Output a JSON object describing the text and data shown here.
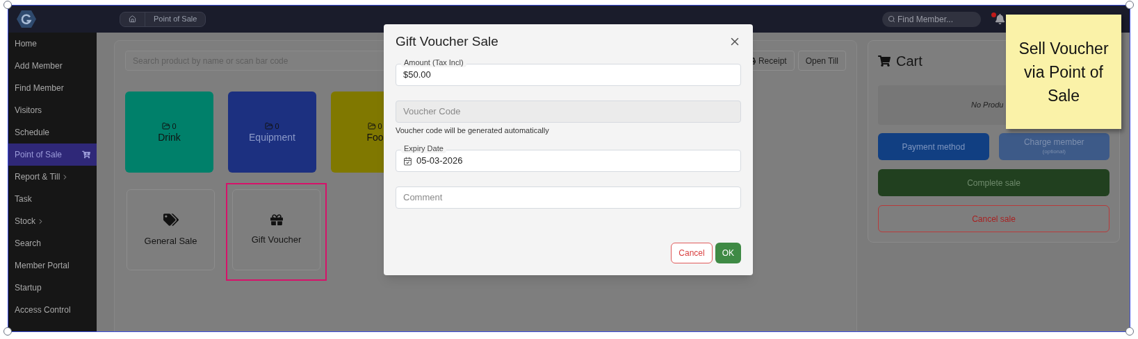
{
  "header": {
    "breadcrumb": [
      "Point of Sale"
    ],
    "search": {
      "placeholder": "Find Member..."
    },
    "unread_notifications": true
  },
  "sidebar": {
    "items": [
      {
        "label": "Home",
        "selected": false,
        "expandable": false
      },
      {
        "label": "Add Member",
        "selected": false,
        "expandable": false
      },
      {
        "label": "Find Member",
        "selected": false,
        "expandable": false
      },
      {
        "label": "Visitors",
        "selected": false,
        "expandable": false
      },
      {
        "label": "Schedule",
        "selected": false,
        "expandable": false
      },
      {
        "label": "Point of Sale",
        "selected": true,
        "expandable": false
      },
      {
        "label": "Report & Till",
        "selected": false,
        "expandable": true
      },
      {
        "label": "Task",
        "selected": false,
        "expandable": false
      },
      {
        "label": "Stock",
        "selected": false,
        "expandable": true
      },
      {
        "label": "Search",
        "selected": false,
        "expandable": false
      },
      {
        "label": "Member Portal",
        "selected": false,
        "expandable": false
      },
      {
        "label": "Startup",
        "selected": false,
        "expandable": false
      },
      {
        "label": "Access Control",
        "selected": false,
        "expandable": false
      }
    ]
  },
  "products": {
    "search": {
      "placeholder": "Search product by name or scan bar code"
    },
    "buttons": [
      {
        "label": "Receipt",
        "kind": "print"
      },
      {
        "label": "Open Till",
        "kind": "plain"
      }
    ],
    "categories": [
      {
        "label": "Drink",
        "count": "0",
        "color": "#00806a"
      },
      {
        "label": "Equipment",
        "count": "0",
        "color": "#1c3080"
      },
      {
        "label": "Foo",
        "count": "0",
        "color": "#807800"
      }
    ],
    "actions": [
      {
        "label": "General Sale",
        "kind": "tags",
        "highlighted": false
      },
      {
        "label": "Gift Voucher",
        "kind": "gift",
        "highlighted": true
      }
    ]
  },
  "cart": {
    "title": "Cart",
    "empty_text": "No Produ",
    "payment_button": "Payment method",
    "charge_button": {
      "label": "Charge member",
      "note": "(optional)"
    },
    "complete_button": "Complete sale",
    "cancel_button": "Cancel sale"
  },
  "dialog": {
    "title": "Gift Voucher Sale",
    "fields": [
      {
        "kind": "text",
        "label": "Amount (Tax Incl)",
        "value": "$50.00"
      },
      {
        "kind": "disabled",
        "placeholder": "Voucher Code",
        "help": "Voucher code will be generated automatically"
      },
      {
        "kind": "date",
        "label": "Expiry Date",
        "value": "05-03-2026"
      },
      {
        "kind": "text",
        "placeholder": "Comment"
      }
    ],
    "buttons": [
      {
        "label": "Cancel",
        "kind": "secondary"
      },
      {
        "label": "OK",
        "kind": "primary"
      }
    ]
  },
  "annotation": {
    "note": "Sell Voucher via Point of Sale"
  }
}
